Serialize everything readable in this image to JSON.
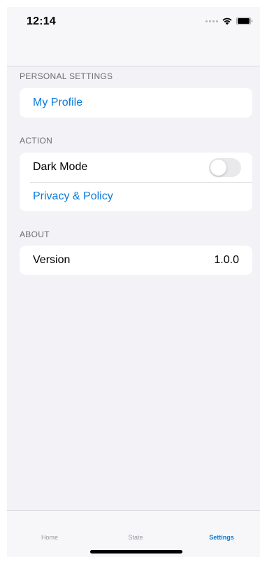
{
  "status_bar": {
    "time": "12:14",
    "icons": [
      "signal-dots-icon",
      "wifi-icon",
      "battery-icon"
    ]
  },
  "sections": {
    "personal": {
      "header": "PERSONAL SETTINGS",
      "rows": [
        {
          "label": "My Profile"
        }
      ]
    },
    "action": {
      "header": "ACTION",
      "rows": [
        {
          "label": "Dark Mode",
          "toggle_on": false
        },
        {
          "label": "Privacy & Policy"
        }
      ]
    },
    "about": {
      "header": "ABOUT",
      "rows": [
        {
          "label": "Version",
          "value": "1.0.0"
        }
      ]
    }
  },
  "tabs": [
    {
      "label": "Home",
      "active": false
    },
    {
      "label": "State",
      "active": false
    },
    {
      "label": "Settings",
      "active": true
    }
  ],
  "colors": {
    "accent": "#0a7ad8",
    "background": "#f2f2f7",
    "toggle_off": "#e9e9eb"
  }
}
